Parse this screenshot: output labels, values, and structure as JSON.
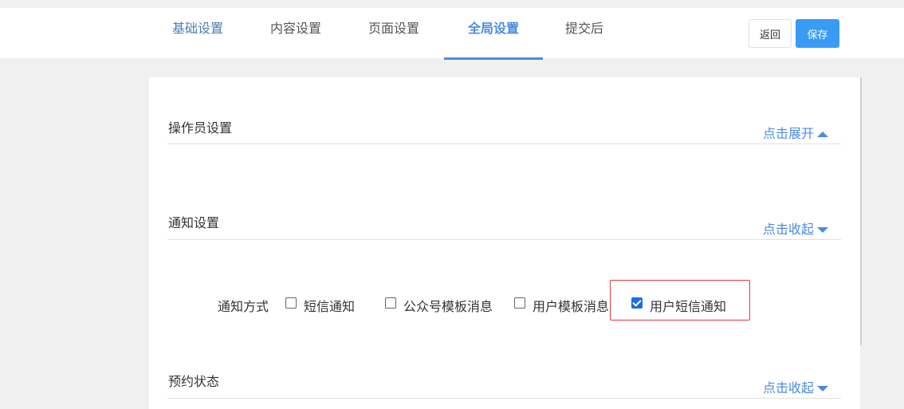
{
  "tabs": [
    {
      "label": "基础设置"
    },
    {
      "label": "内容设置"
    },
    {
      "label": "页面设置"
    },
    {
      "label": "全局设置",
      "active": true
    },
    {
      "label": "提交后"
    }
  ],
  "actions": {
    "back_label": "返回",
    "save_label": "保存"
  },
  "sections": [
    {
      "title": "操作员设置",
      "toggle": "点击展开",
      "arrow": "up"
    },
    {
      "title": "通知设置",
      "toggle": "点击收起",
      "arrow": "down"
    },
    {
      "title": "预约状态",
      "toggle": "点击收起",
      "arrow": "down"
    }
  ],
  "notify": {
    "label": "通知方式",
    "options": [
      {
        "label": "短信通知",
        "checked": false
      },
      {
        "label": "公众号模板消息",
        "checked": false
      },
      {
        "label": "用户模板消息",
        "checked": false
      },
      {
        "label": "用户短信通知",
        "checked": true
      }
    ]
  },
  "colors": {
    "accent": "#4a8be0",
    "save_button": "#3a9bf5",
    "highlight": "#e0383e"
  }
}
